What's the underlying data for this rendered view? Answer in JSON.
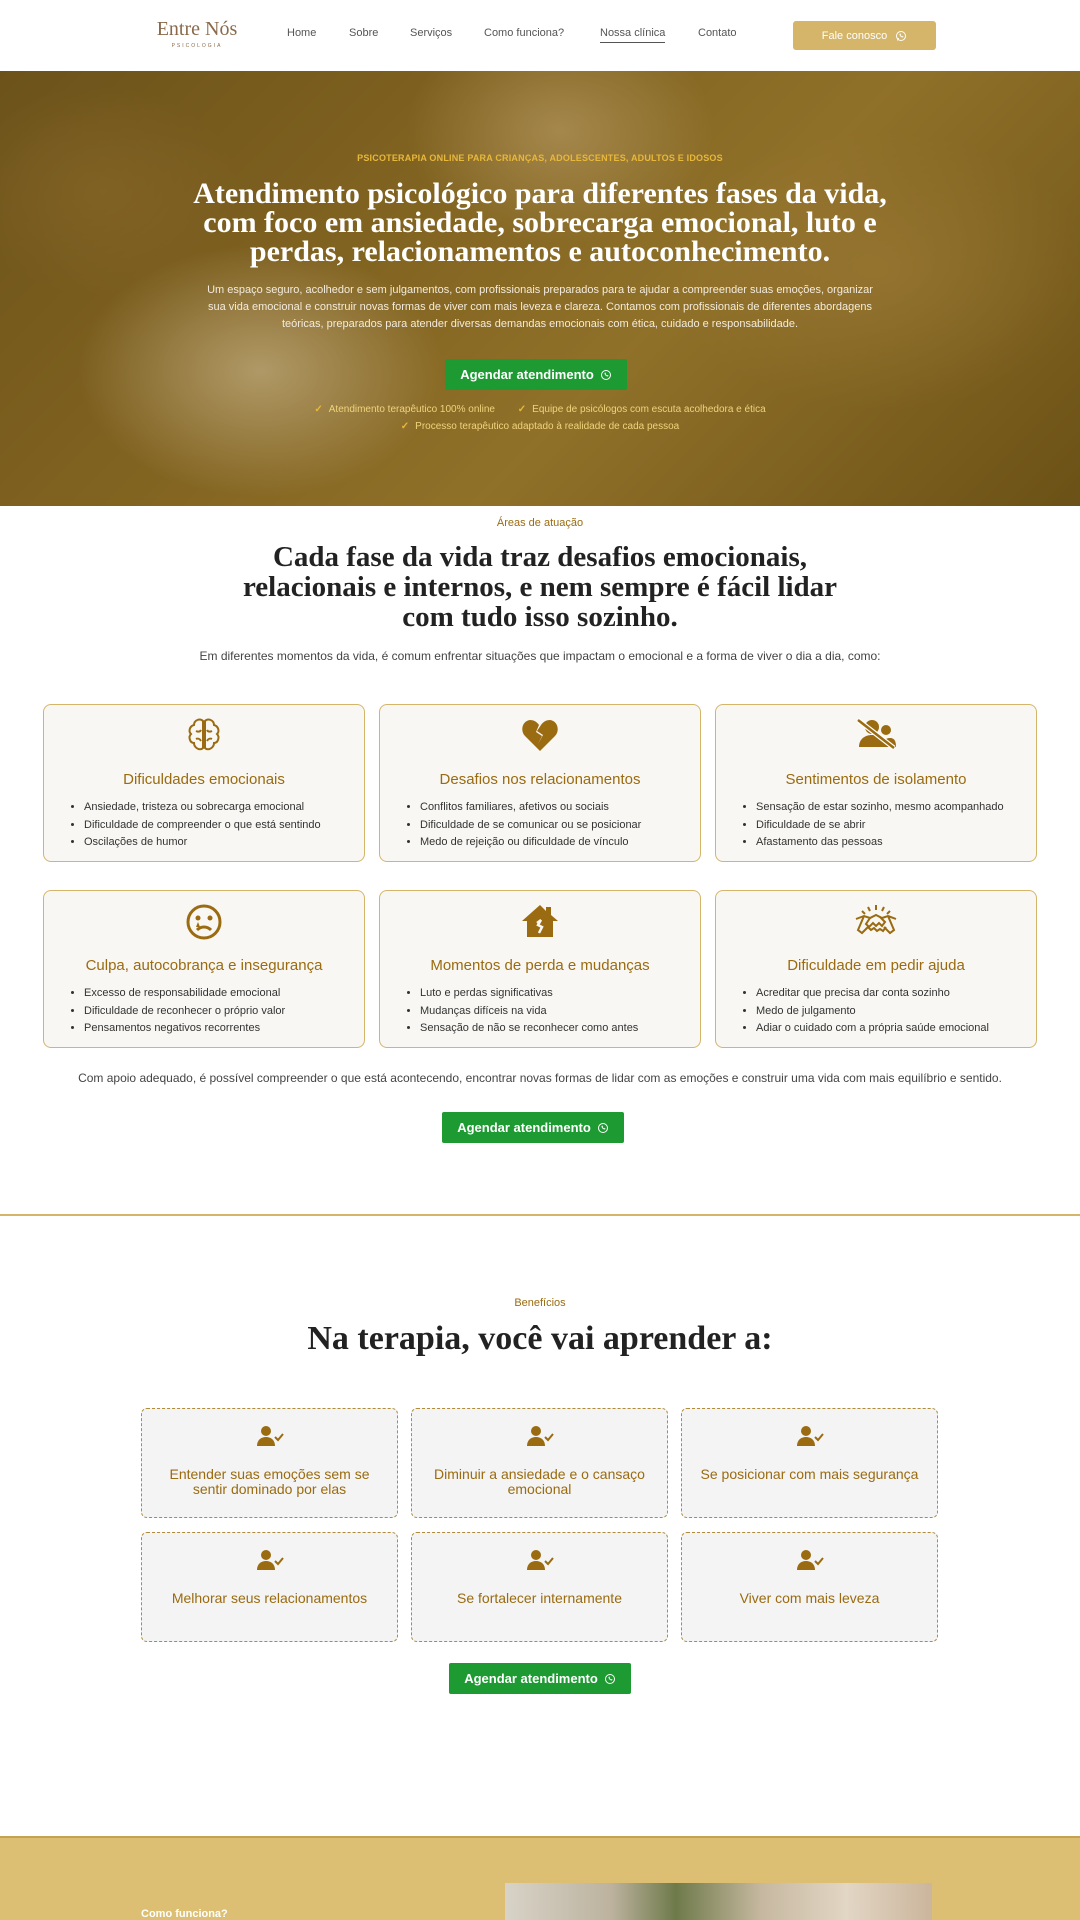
{
  "header": {
    "logo_main": "Entre Nós",
    "logo_sub": "PSICOLOGIA",
    "nav": [
      "Home",
      "Sobre",
      "Serviços",
      "Como funciona?",
      "Nossa clínica",
      "Contato"
    ],
    "cta": "Fale conosco"
  },
  "hero": {
    "eyebrow": "PSICOTERAPIA ONLINE PARA CRIANÇAS, ADOLESCENTES, ADULTOS E IDOSOS",
    "title_lines": [
      "Atendimento psicológico para diferentes fases da vida,",
      "com foco em ansiedade, sobrecarga emocional, luto e",
      "perdas, relacionamentos e autoconhecimento."
    ],
    "desc_lines": [
      "Um espaço seguro, acolhedor e sem julgamentos, com profissionais preparados para te ajudar a compreender suas emoções, organizar",
      "sua vida emocional e construir novas formas de viver com mais leveza e clareza. Contamos com profissionais de diferentes abordagens",
      "teóricas, preparados para atender diversas demandas emocionais com ética, cuidado e responsabilidade."
    ],
    "button": "Agendar atendimento",
    "checks": [
      "Atendimento terapêutico 100% online",
      "Equipe de psicólogos com escuta acolhedora e ética",
      "Processo terapêutico adaptado à realidade de cada pessoa"
    ]
  },
  "areas": {
    "eyebrow": "Áreas de atuação",
    "title_lines": [
      "Cada fase da vida traz desafios emocionais,",
      "relacionais e internos, e nem sempre é fácil lidar",
      "com tudo isso sozinho."
    ],
    "subtitle": "Em diferentes momentos da vida, é comum enfrentar situações que impactam o emocional e a forma de viver o dia a dia, como:",
    "cards": [
      {
        "icon": "brain-icon",
        "title": "Dificuldades emocionais",
        "items": [
          "Ansiedade, tristeza ou sobrecarga emocional",
          "Dificuldade de compreender o que está sentindo",
          "Oscilações de humor"
        ]
      },
      {
        "icon": "broken-heart-icon",
        "title": "Desafios nos relacionamentos",
        "items": [
          "Conflitos familiares, afetivos ou sociais",
          "Dificuldade de se comunicar ou se posicionar",
          "Medo de rejeição ou dificuldade de vínculo"
        ]
      },
      {
        "icon": "user-slash-icon",
        "title": "Sentimentos de isolamento",
        "items": [
          "Sensação de estar sozinho, mesmo acompanhado",
          "Dificuldade de se abrir",
          "Afastamento das pessoas"
        ]
      },
      {
        "icon": "sad-face-icon",
        "title": "Culpa, autocobrança e insegurança",
        "items": [
          "Excesso de responsabilidade emocional",
          "Dificuldade de reconhecer o próprio valor",
          "Pensamentos negativos recorrentes"
        ]
      },
      {
        "icon": "house-damage-icon",
        "title": "Momentos de perda e mudanças",
        "items": [
          "Luto e perdas significativas",
          "Mudanças difíceis na vida",
          "Sensação de não se reconhecer como antes"
        ]
      },
      {
        "icon": "handshake-icon",
        "title": "Dificuldade em pedir ajuda",
        "items": [
          "Acreditar que precisa dar conta sozinho",
          "Medo de julgamento",
          "Adiar o cuidado com a própria saúde emocional"
        ]
      }
    ],
    "note": "Com apoio adequado, é possível compreender o que está acontecendo, encontrar novas formas de lidar com as emoções e construir uma vida com mais equilíbrio e sentido.",
    "button": "Agendar atendimento"
  },
  "benefits": {
    "eyebrow": "Benefícios",
    "title": "Na terapia, você vai aprender a:",
    "cards": [
      [
        "Entender suas emoções sem se",
        "sentir dominado por elas"
      ],
      [
        "Diminuir a ansiedade e o cansaço",
        "emocional"
      ],
      [
        "Se posicionar com mais segurança"
      ],
      [
        "Melhorar seus relacionamentos"
      ],
      [
        "Se fortalecer internamente"
      ],
      [
        "Viver com mais leveza"
      ]
    ],
    "icon": "user-check-icon",
    "button": "Agendar atendimento"
  },
  "bottom": {
    "label": "Como funciona?"
  },
  "colors": {
    "gold": "#d4b56a",
    "brown": "#9a6b10",
    "green": "#1e9a33"
  }
}
